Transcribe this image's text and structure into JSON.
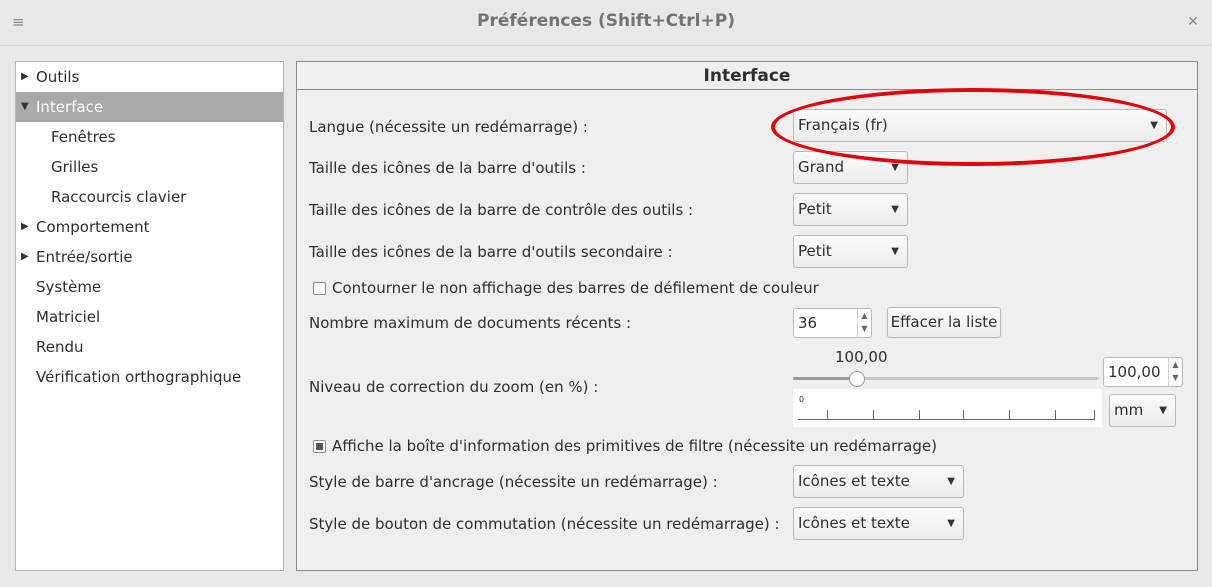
{
  "window": {
    "title": "Préférences (Shift+Ctrl+P)",
    "menu_icon": "menu-icon",
    "close_icon": "close-icon"
  },
  "sidebar": {
    "items": [
      {
        "label": "Outils",
        "expander": "right"
      },
      {
        "label": "Interface",
        "expander": "down",
        "selected": true
      },
      {
        "label": "Fenêtres"
      },
      {
        "label": "Grilles"
      },
      {
        "label": "Raccourcis clavier"
      },
      {
        "label": "Comportement",
        "expander": "right"
      },
      {
        "label": "Entrée/sortie",
        "expander": "right"
      },
      {
        "label": "Système"
      },
      {
        "label": "Matriciel"
      },
      {
        "label": "Rendu"
      },
      {
        "label": "Vérification orthographique"
      }
    ]
  },
  "panel": {
    "title": "Interface",
    "language": {
      "label": "Langue (nécessite un redémarrage) :",
      "value": "Français (fr)"
    },
    "toolbar_icon_size": {
      "label": "Taille des icônes de la barre d'outils :",
      "value": "Grand"
    },
    "toolcontrol_icon_size": {
      "label": "Taille des icônes de la barre de contrôle des outils :",
      "value": "Petit"
    },
    "secondary_icon_size": {
      "label": "Taille des icônes de la barre d'outils secondaire :",
      "value": "Petit"
    },
    "scrollbar_workaround": {
      "label": "Contourner le non affichage des barres de défilement de couleur",
      "checked": false
    },
    "recent_docs": {
      "label": "Nombre maximum de documents récents :",
      "value": "36",
      "clear_label": "Effacer la liste"
    },
    "zoom": {
      "label": "Niveau de correction du zoom (en %) :",
      "slider_value_text": "100,00",
      "spin_value": "100,00",
      "unit": "mm",
      "ruler_zero": "0",
      "slider_fraction": 0.2
    },
    "filter_info": {
      "label": "Affiche la boîte d'information des primitives de filtre (nécessite un redémarrage)",
      "checked": true
    },
    "dock_style": {
      "label": "Style de barre d'ancrage (nécessite un redémarrage) :",
      "value": "Icônes et texte"
    },
    "switcher_style": {
      "label": "Style de bouton de commutation (nécessite un redémarrage) :",
      "value": "Icônes et texte"
    }
  },
  "colors": {
    "annotation": "#e3000b",
    "selection": "#a9a9a9"
  }
}
